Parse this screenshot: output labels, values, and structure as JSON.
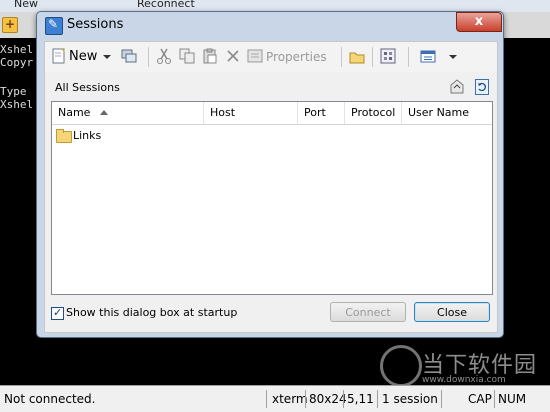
{
  "app": {
    "toolbar": {
      "new_label": "New",
      "reconnect_label": "Reconnect"
    },
    "tab_add": "+",
    "terminal_lines": [
      "Xshel",
      "Copyr",
      "",
      "Type",
      "Xshel"
    ],
    "statusbar": {
      "connection": "Not connected.",
      "term_type": "xterm",
      "size": "80x24",
      "cursor": "5,11",
      "sessions": "1 session",
      "cap": "CAP",
      "num": "NUM"
    },
    "watermark": {
      "text": "当下软件园",
      "url": "www.downxia.com"
    }
  },
  "dialog": {
    "title": "Sessions",
    "close_glyph": "x",
    "toolbar": {
      "new_label": "New",
      "properties_label": "Properties"
    },
    "path": "All Sessions",
    "columns": [
      "Name",
      "Host",
      "Port",
      "Protocol",
      "User Name"
    ],
    "rows": [
      {
        "name": "Links",
        "type": "folder"
      }
    ],
    "startup_checkbox": {
      "label": "Show this dialog box at startup",
      "checked": true
    },
    "buttons": {
      "connect": "Connect",
      "close": "Close"
    }
  },
  "colors": {
    "dialog_frame": "#c8d6e8",
    "close_button": "#c8402c",
    "terminal_bg": "#000000"
  }
}
